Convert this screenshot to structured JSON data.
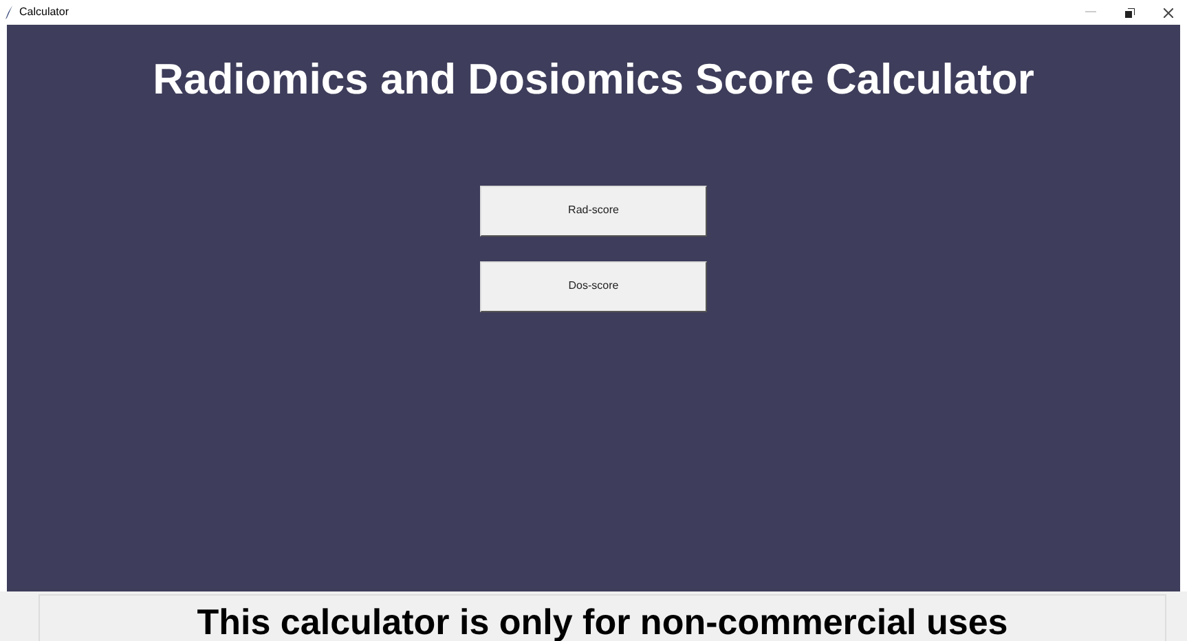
{
  "window": {
    "title": "Calculator"
  },
  "heading": "Radiomics and Dosiomics Score Calculator",
  "buttons": [
    "Rad-score",
    "Dos-score"
  ],
  "footer": "This calculator is only for non-commercial uses"
}
